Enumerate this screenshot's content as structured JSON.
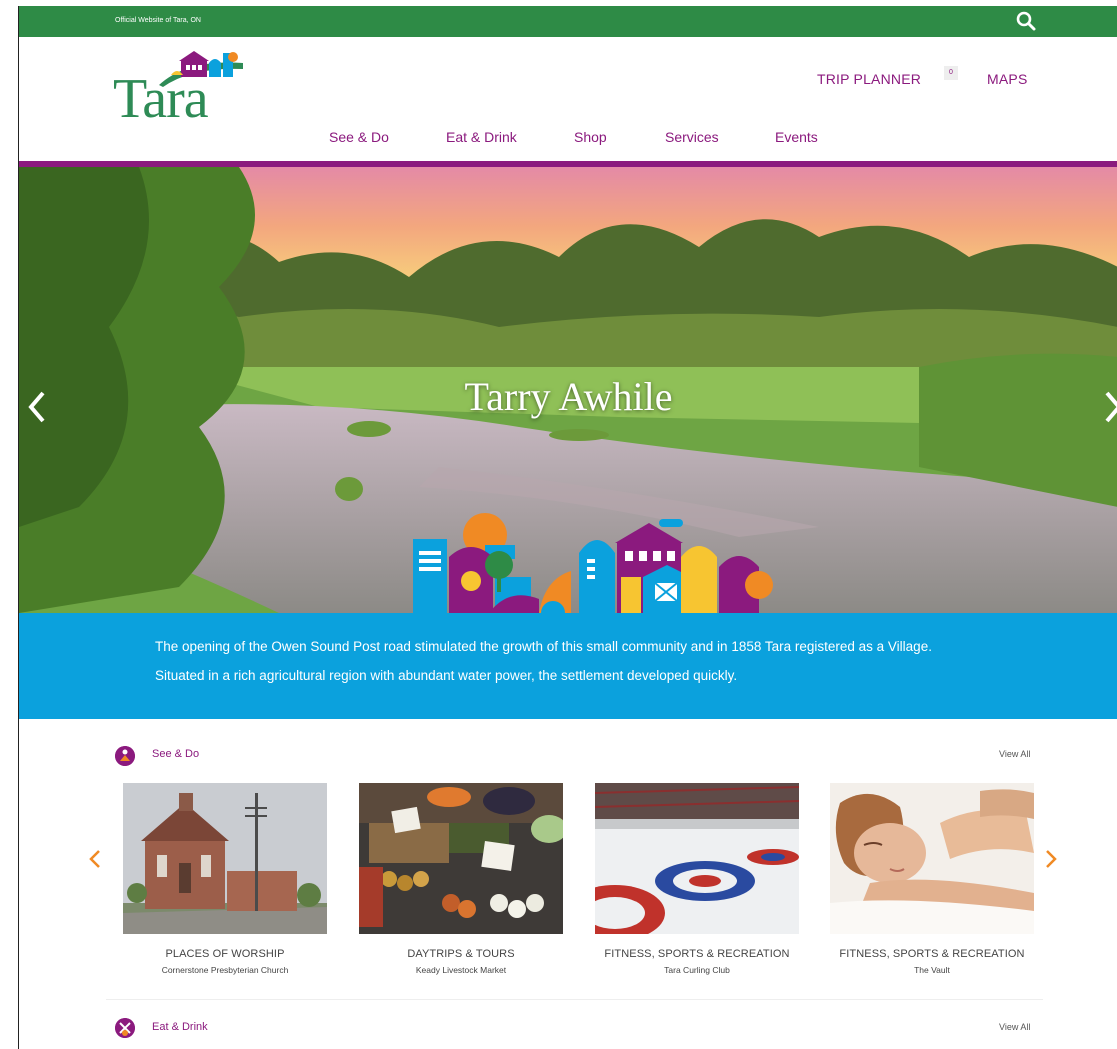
{
  "topbar": {
    "official_text": "Official Website of Tara, ON",
    "search_icon": "search-icon"
  },
  "header": {
    "logo_text": "Tara",
    "trip_planner": "TRIP PLANNER",
    "trip_count": "0",
    "maps": "MAPS",
    "nav": [
      "See & Do",
      "Eat & Drink",
      "Shop",
      "Services",
      "Events"
    ]
  },
  "hero": {
    "title": "Tarry Awhile",
    "prev_icon": "chevron-left-icon",
    "next_icon": "chevron-right-icon"
  },
  "intro": {
    "line1": "The opening of the Owen Sound Post road stimulated the growth of this small community and in 1858 Tara registered as a Village.",
    "line2": "Situated in a rich agricultural region with abundant  water power, the settlement developed quickly."
  },
  "sections": [
    {
      "title": "See & Do",
      "view_all": "View All",
      "cards": [
        {
          "category": "PLACES OF WORSHIP",
          "name": "Cornerstone Presbyterian Church"
        },
        {
          "category": "DAYTRIPS & TOURS",
          "name": "Keady Livestock Market"
        },
        {
          "category": "FITNESS, SPORTS & RECREATION",
          "name": "Tara Curling Club"
        },
        {
          "category": "FITNESS, SPORTS & RECREATION",
          "name": "The Vault"
        }
      ]
    },
    {
      "title": "Eat & Drink",
      "view_all": "View All"
    }
  ],
  "colors": {
    "green": "#2e8b46",
    "purple": "#8b1a7e",
    "blue": "#0ba1dd",
    "orange": "#f08a24"
  }
}
